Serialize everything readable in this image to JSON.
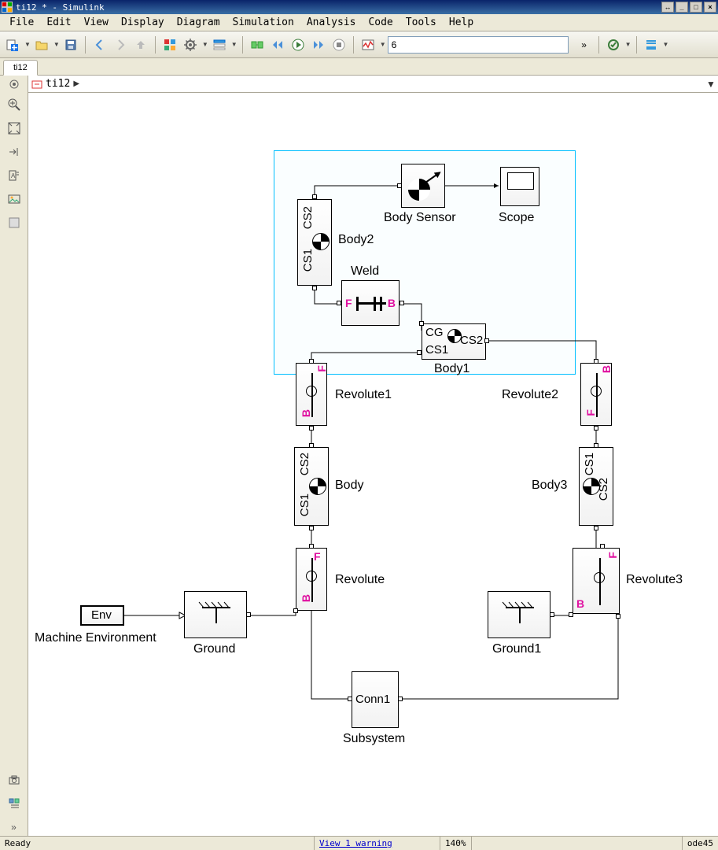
{
  "window": {
    "title": "ti12 * - Simulink"
  },
  "menu": {
    "items": [
      "File",
      "Edit",
      "View",
      "Display",
      "Diagram",
      "Simulation",
      "Analysis",
      "Code",
      "Tools",
      "Help"
    ]
  },
  "toolbar": {
    "stop_time": "6"
  },
  "tabs": {
    "items": [
      "ti12"
    ]
  },
  "breadcrumb": {
    "model": "ti12"
  },
  "blocks": {
    "body_sensor": {
      "label": "Body Sensor"
    },
    "scope": {
      "label": "Scope"
    },
    "body2": {
      "label": "Body2",
      "port1": "CS1",
      "port2": "CS2"
    },
    "weld": {
      "label": "Weld",
      "portF": "F",
      "portB": "B"
    },
    "body1": {
      "label": "Body1",
      "cg": "CG",
      "cs1": "CS1",
      "cs2": "CS2"
    },
    "revolute1": {
      "label": "Revolute1",
      "portF": "F",
      "portB": "B"
    },
    "revolute2": {
      "label": "Revolute2",
      "portF": "F",
      "portB": "B"
    },
    "body": {
      "label": "Body",
      "port1": "CS1",
      "port2": "CS2"
    },
    "body3": {
      "label": "Body3",
      "port1": "CS1",
      "port2": "CS2"
    },
    "revolute": {
      "label": "Revolute",
      "portF": "F",
      "portB": "B"
    },
    "revolute3": {
      "label": "Revolute3",
      "portF": "F",
      "portB": "B"
    },
    "env": {
      "label": "Machine Environment",
      "text": "Env"
    },
    "ground": {
      "label": "Ground"
    },
    "ground1": {
      "label": "Ground1"
    },
    "subsystem": {
      "label": "Subsystem",
      "conn1": "Conn1"
    }
  },
  "status": {
    "ready": "Ready",
    "warning": "View 1 warning",
    "zoom": "140%",
    "solver": "ode45"
  }
}
